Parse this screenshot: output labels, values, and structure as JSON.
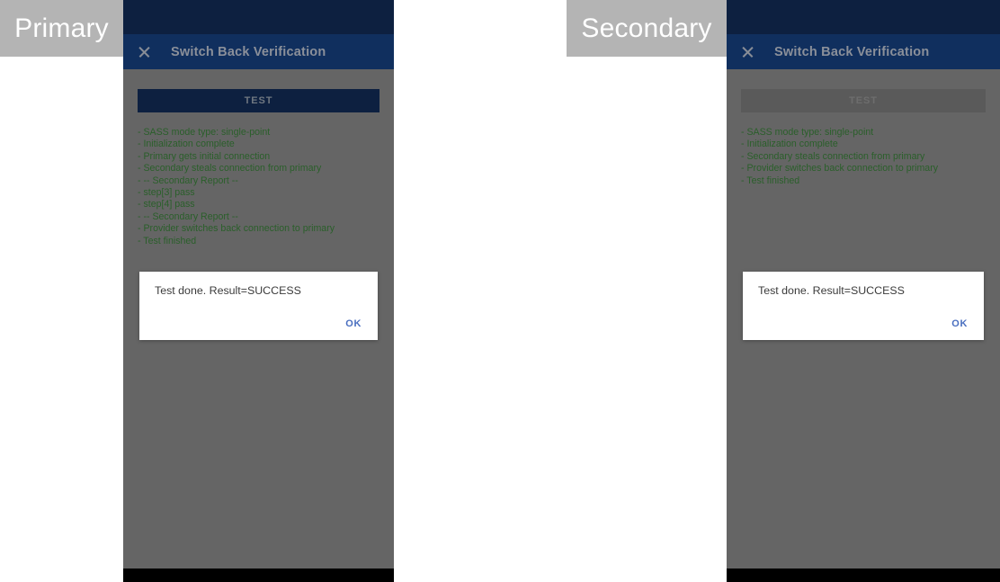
{
  "captions": {
    "primary": "Primary",
    "secondary": "Secondary"
  },
  "colors": {
    "status_bar": "#0d2040",
    "toolbar": "#102f5e",
    "body": "#656565",
    "log_text": "#2a5f2a",
    "dialog_action": "#4a6fc0",
    "caption_bg": "#b4b4b4",
    "nav_bar": "#000000"
  },
  "primary": {
    "toolbar": {
      "close_icon": "close-icon",
      "title": "Switch Back Verification"
    },
    "test_button": {
      "label": "TEST",
      "state": "enabled"
    },
    "log_lines": [
      "- SASS mode type: single-point",
      "- Initialization complete",
      "- Primary gets initial connection",
      "- Secondary steals connection from primary",
      "- -- Secondary Report --",
      "- step[3] pass",
      "- step[4] pass",
      "- -- Secondary Report --",
      "- Provider switches back connection to primary",
      "- Test finished"
    ],
    "dialog": {
      "message": "Test done. Result=SUCCESS",
      "ok_label": "OK"
    }
  },
  "secondary": {
    "toolbar": {
      "close_icon": "close-icon",
      "title": "Switch Back Verification"
    },
    "test_button": {
      "label": "TEST",
      "state": "disabled"
    },
    "log_lines": [
      "- SASS mode type: single-point",
      "- Initialization complete",
      "- Secondary steals connection from primary",
      "- Provider switches back connection to primary",
      "- Test finished"
    ],
    "dialog": {
      "message": "Test done. Result=SUCCESS",
      "ok_label": "OK"
    }
  }
}
